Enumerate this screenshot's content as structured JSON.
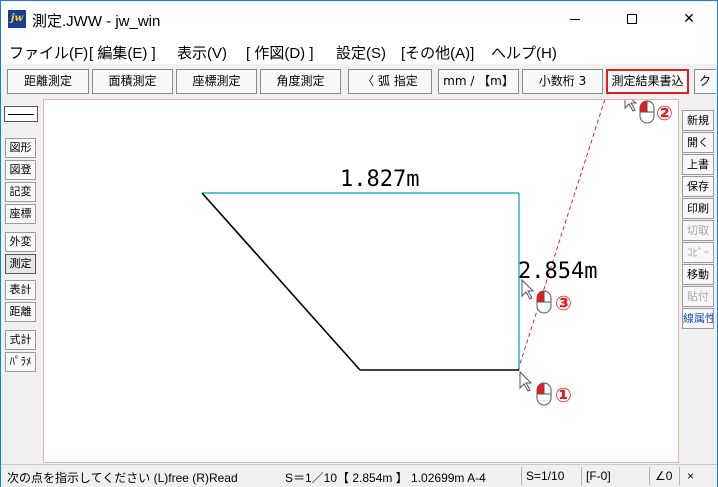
{
  "window": {
    "title": "測定.JWW - jw_win",
    "app_icon_text": "jw"
  },
  "menu": [
    {
      "label": "ファイル(F)"
    },
    {
      "label": "[ 編集(E) ]"
    },
    {
      "label": "表示(V)"
    },
    {
      "label": "[ 作図(D) ]"
    },
    {
      "label": "設定(S)"
    },
    {
      "label": "[その他(A)]"
    },
    {
      "label": "ヘルプ(H)"
    }
  ],
  "toolbar": [
    {
      "label": "距離測定"
    },
    {
      "label": "面積測定"
    },
    {
      "label": "座標測定"
    },
    {
      "label": "角度測定"
    },
    {
      "label": "〈 弧 指定"
    },
    {
      "label": "mm / 【m】"
    },
    {
      "label": "小数桁 3"
    },
    {
      "label": "測定結果書込"
    }
  ],
  "toolbar_tail": "ク",
  "left_panel": [
    {
      "label": "図形"
    },
    {
      "label": "図登"
    },
    {
      "label": "記変"
    },
    {
      "label": "座標"
    },
    {
      "label": "外変"
    },
    {
      "label": "測定"
    },
    {
      "label": "表計"
    },
    {
      "label": "距離"
    },
    {
      "label": "式計"
    },
    {
      "label": "ﾊﾟﾗﾒ"
    }
  ],
  "right_panel": [
    {
      "label": "新規"
    },
    {
      "label": "開く"
    },
    {
      "label": "上書"
    },
    {
      "label": "保存"
    },
    {
      "label": "印刷"
    },
    {
      "label": "切取"
    },
    {
      "label": "ｺﾋﾟｰ"
    },
    {
      "label": "移動"
    },
    {
      "label": "貼付"
    },
    {
      "label": "線属性"
    }
  ],
  "drawing": {
    "top_dimension": "1.827m",
    "right_dimension": "2.854m",
    "markers": [
      "①",
      "②",
      "③"
    ]
  },
  "status": {
    "message": "次の点を指示してください (L)free (R)Read",
    "scale_info": "S＝1／10【 2.854m 】 1.02699m A-4",
    "scale": "S=1/10",
    "layer": "[F-0]",
    "angle": "∠0",
    "zoom": "×"
  },
  "colors": {
    "highlight_border": "#e02020",
    "dashed_guide": "#e02020",
    "active_line": "#00a0b0",
    "window_border": "#1a7fd4",
    "blue_text": "#1f4fbf"
  }
}
